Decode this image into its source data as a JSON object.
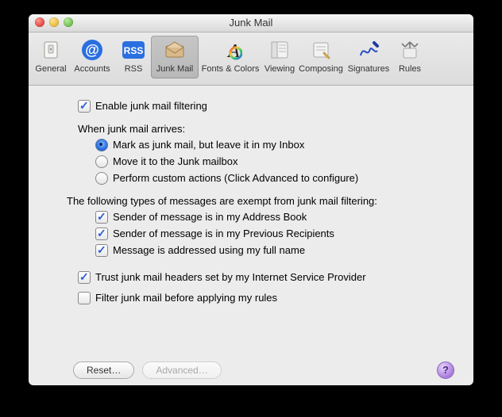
{
  "title": "Junk Mail",
  "toolbar": [
    {
      "name": "general",
      "label": "General"
    },
    {
      "name": "accounts",
      "label": "Accounts"
    },
    {
      "name": "rss",
      "label": "RSS"
    },
    {
      "name": "junkmail",
      "label": "Junk Mail",
      "selected": true
    },
    {
      "name": "fontscolors",
      "label": "Fonts & Colors"
    },
    {
      "name": "viewing",
      "label": "Viewing"
    },
    {
      "name": "composing",
      "label": "Composing"
    },
    {
      "name": "signatures",
      "label": "Signatures"
    },
    {
      "name": "rules",
      "label": "Rules"
    }
  ],
  "enable": {
    "label": "Enable junk mail filtering",
    "checked": true
  },
  "arrives": {
    "heading": "When junk mail arrives:",
    "options": [
      {
        "label": "Mark as junk mail, but leave it in my Inbox",
        "selected": true
      },
      {
        "label": "Move it to the Junk mailbox",
        "selected": false
      },
      {
        "label": "Perform custom actions (Click Advanced to configure)",
        "selected": false
      }
    ]
  },
  "exempt": {
    "heading": "The following types of messages are exempt from junk mail filtering:",
    "items": [
      {
        "label": "Sender of message is in my Address Book",
        "checked": true
      },
      {
        "label": "Sender of message is in my Previous Recipients",
        "checked": true
      },
      {
        "label": "Message is addressed using my full name",
        "checked": true
      }
    ]
  },
  "trust": {
    "label": "Trust junk mail headers set by my Internet Service Provider",
    "checked": true
  },
  "filterBefore": {
    "label": "Filter junk mail before applying my rules",
    "checked": false
  },
  "buttons": {
    "reset": "Reset…",
    "advanced": "Advanced…"
  },
  "help": "?"
}
